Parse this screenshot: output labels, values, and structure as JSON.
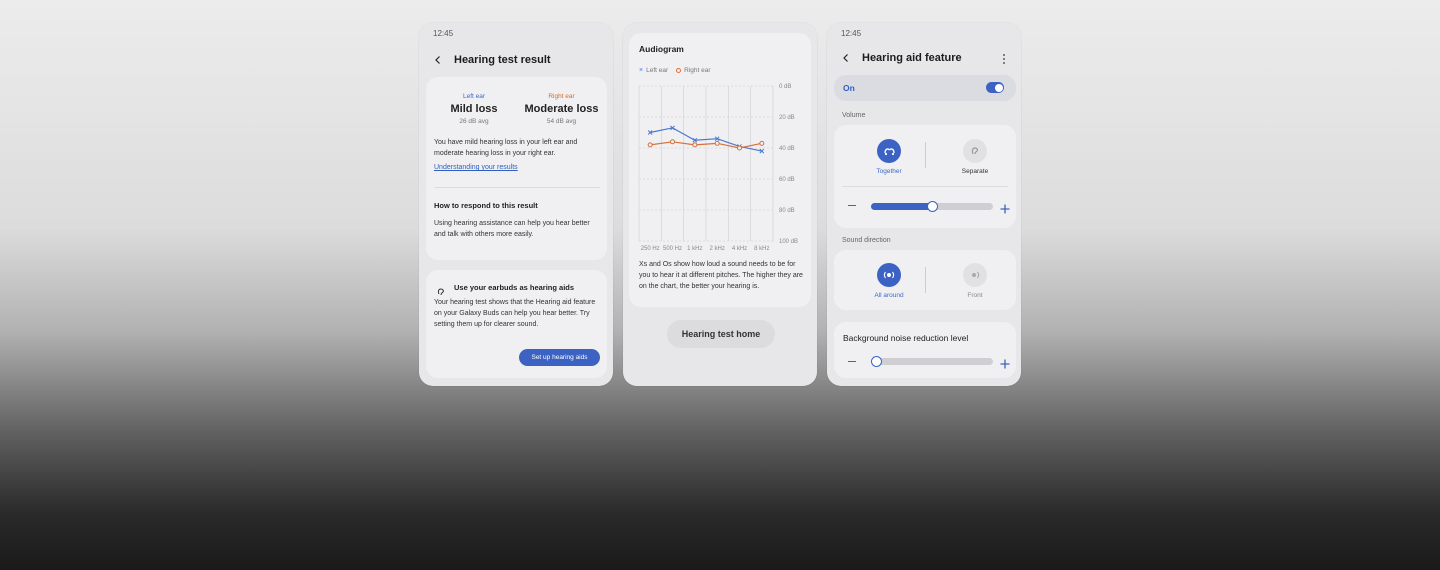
{
  "result_screen": {
    "status_time": "12:45",
    "title": "Hearing test result",
    "left": {
      "label": "Left ear",
      "level": "Mild loss",
      "avg": "26 dB avg"
    },
    "right": {
      "label": "Right ear",
      "level": "Moderate loss",
      "avg": "54 dB avg"
    },
    "summary": "You have mild hearing loss in your left ear and moderate hearing loss in your right ear.",
    "link": "Understanding your results",
    "respond_heading": "How to respond to this result",
    "respond_body": "Using hearing assistance can help you hear better and talk with others more easily.",
    "earbuds_title": "Use your earbuds as hearing aids",
    "earbuds_body": "Your hearing test shows that the Hearing aid feature on your Galaxy Buds can help you hear better. Try setting them up for clearer sound.",
    "setup_button": "Set up hearing aids"
  },
  "audiogram_screen": {
    "title": "Audiogram",
    "legend_left": "Left ear",
    "legend_right": "Right ear",
    "description": "Xs and Os show how loud a sound needs to be for you to hear it at different pitches. The higher they are on the chart, the better your hearing is.",
    "home_button": "Hearing test home"
  },
  "chart_data": {
    "type": "line",
    "categories": [
      "250 Hz",
      "500 Hz",
      "1 kHz",
      "2 kHz",
      "4 kHz",
      "8 kHz"
    ],
    "y_ticks": [
      "0 dB",
      "20 dB",
      "40 dB",
      "60 dB",
      "80 dB",
      "100 dB"
    ],
    "ylim": [
      0,
      100
    ],
    "y_inverted": true,
    "x_points": [
      0,
      1,
      2,
      3,
      4,
      5
    ],
    "series": [
      {
        "name": "Left ear",
        "marker": "x",
        "color": "#4a78cf",
        "x": [
          0,
          1,
          2,
          3,
          4,
          5
        ],
        "values": [
          30,
          27,
          35,
          34,
          39,
          42
        ]
      },
      {
        "name": "Right ear",
        "marker": "o",
        "color": "#d8703a",
        "x": [
          0,
          1,
          2,
          3,
          4,
          5
        ],
        "values": [
          38,
          36,
          38,
          37,
          40,
          37
        ]
      }
    ],
    "grid": true
  },
  "aid_screen": {
    "status_time": "12:45",
    "title": "Hearing aid feature",
    "on_label": "On",
    "volume_label": "Volume",
    "together_label": "Together",
    "separate_label": "Separate",
    "volume_level": 0.5,
    "sound_direction_label": "Sound direction",
    "all_around_label": "All around",
    "front_label": "Front",
    "noise_label": "Background noise reduction level",
    "noise_level": 0.0
  },
  "colors": {
    "accent": "#3c63c3",
    "left_ear": "#4a78cf",
    "right_ear": "#d8703a"
  }
}
